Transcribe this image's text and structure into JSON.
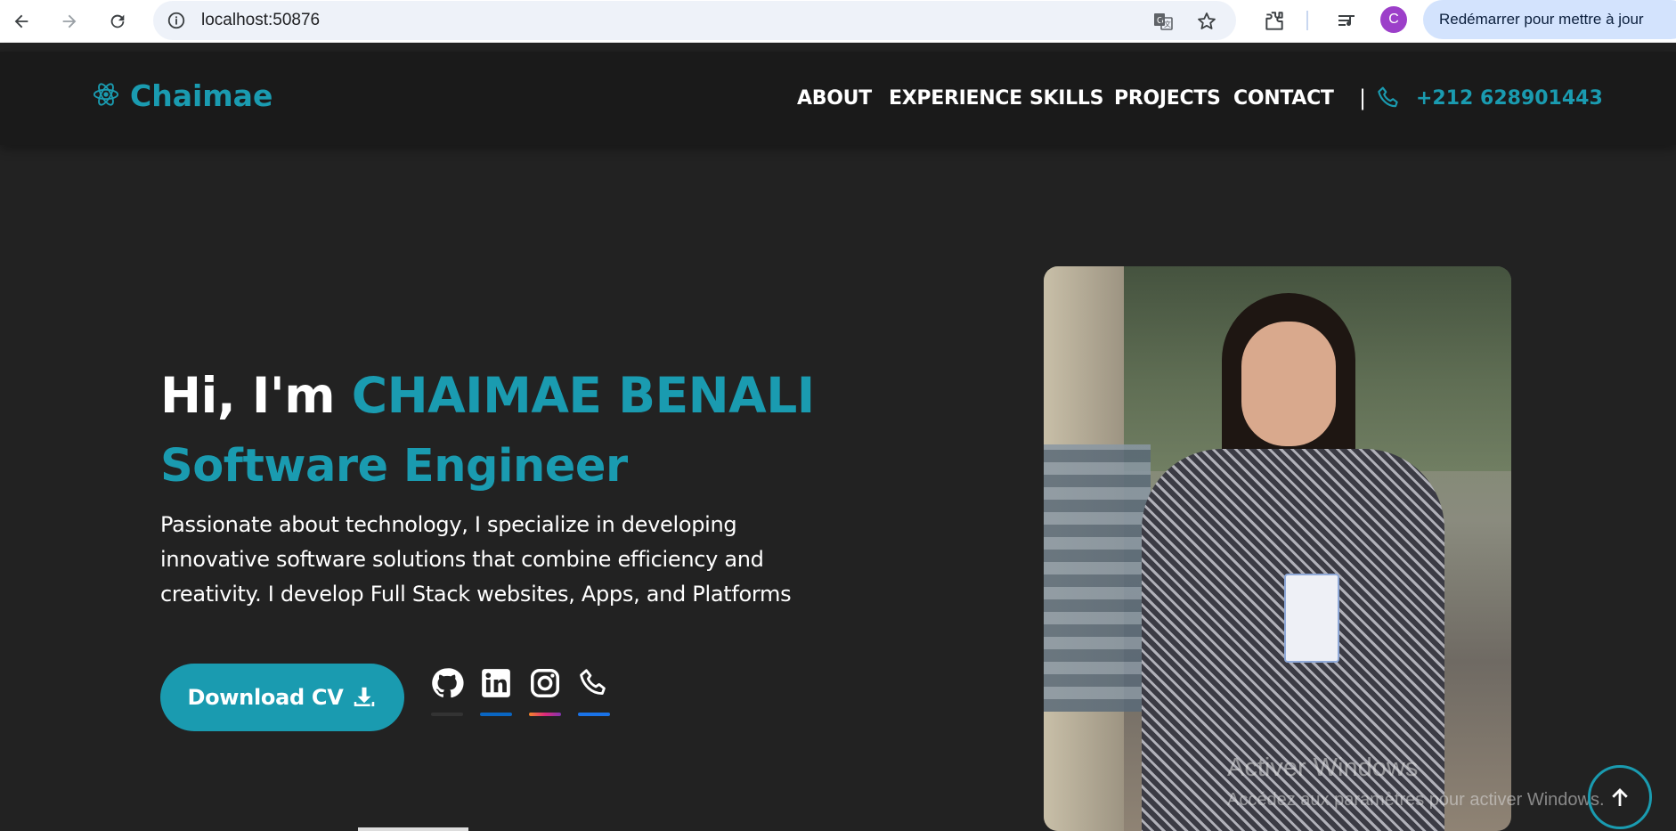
{
  "browser": {
    "url": "localhost:50876",
    "profile_initial": "C",
    "relaunch_label": "Redémarrer pour mettre à jour",
    "icons": [
      "back-icon",
      "forward-icon",
      "reload-icon",
      "site-info-icon",
      "translate-icon",
      "star-icon",
      "extensions-icon",
      "media-controls-icon"
    ]
  },
  "header": {
    "brand": "Chaimae",
    "nav": [
      "ABOUT",
      "EXPERIENCE",
      "SKILLS",
      "PROJECTS",
      "CONTACT"
    ],
    "separator": "|",
    "phone": "+212 628901443"
  },
  "hero": {
    "greeting": "Hi, I'm",
    "name": "CHAIMAE BENALI",
    "role": "Software Engineer",
    "description": "Passionate about technology, I specialize in developing innovative software solutions that combine efficiency and creativity. I develop Full Stack websites, Apps, and Platforms",
    "cv_button": "Download CV",
    "socials": [
      {
        "name": "github-icon",
        "color": "#333333"
      },
      {
        "name": "linkedin-icon",
        "color": "#0a66c2"
      },
      {
        "name": "instagram-icon",
        "color": "#e1306c"
      },
      {
        "name": "phone-icon",
        "color": "#1a73e8"
      }
    ]
  },
  "watermark": {
    "line1": "Activer Windows",
    "line2": "Accédez aux paramètres pour activer Windows."
  },
  "colors": {
    "accent": "#1a9bb0",
    "background": "#222222",
    "header_bg": "#1a1a1a"
  }
}
